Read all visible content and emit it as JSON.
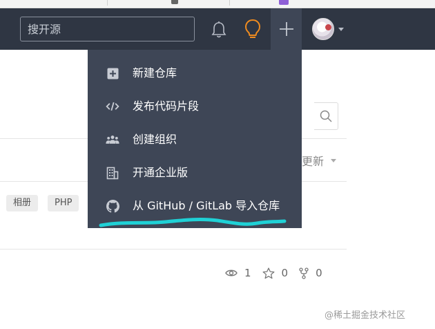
{
  "header": {
    "search_placeholder": "搜开源"
  },
  "new_menu": {
    "items": [
      {
        "label": "新建仓库",
        "icon": "plus-square-icon"
      },
      {
        "label": "发布代码片段",
        "icon": "code-icon"
      },
      {
        "label": "创建组织",
        "icon": "users-icon"
      },
      {
        "label": "开通企业版",
        "icon": "building-icon"
      },
      {
        "label": "从 GitHub / GitLab 导入仓库",
        "icon": "github-icon"
      }
    ]
  },
  "page": {
    "sort_label": "更新",
    "tags": [
      "相册",
      "PHP"
    ],
    "stats": {
      "watch": "1",
      "star": "0",
      "fork": "0"
    }
  },
  "watermark": "@稀土掘金技术社区",
  "colors": {
    "navbar": "#2f3643",
    "dropdown": "#3e4656",
    "bulb": "#f08c1f",
    "annotation": "#1fd1d6"
  }
}
